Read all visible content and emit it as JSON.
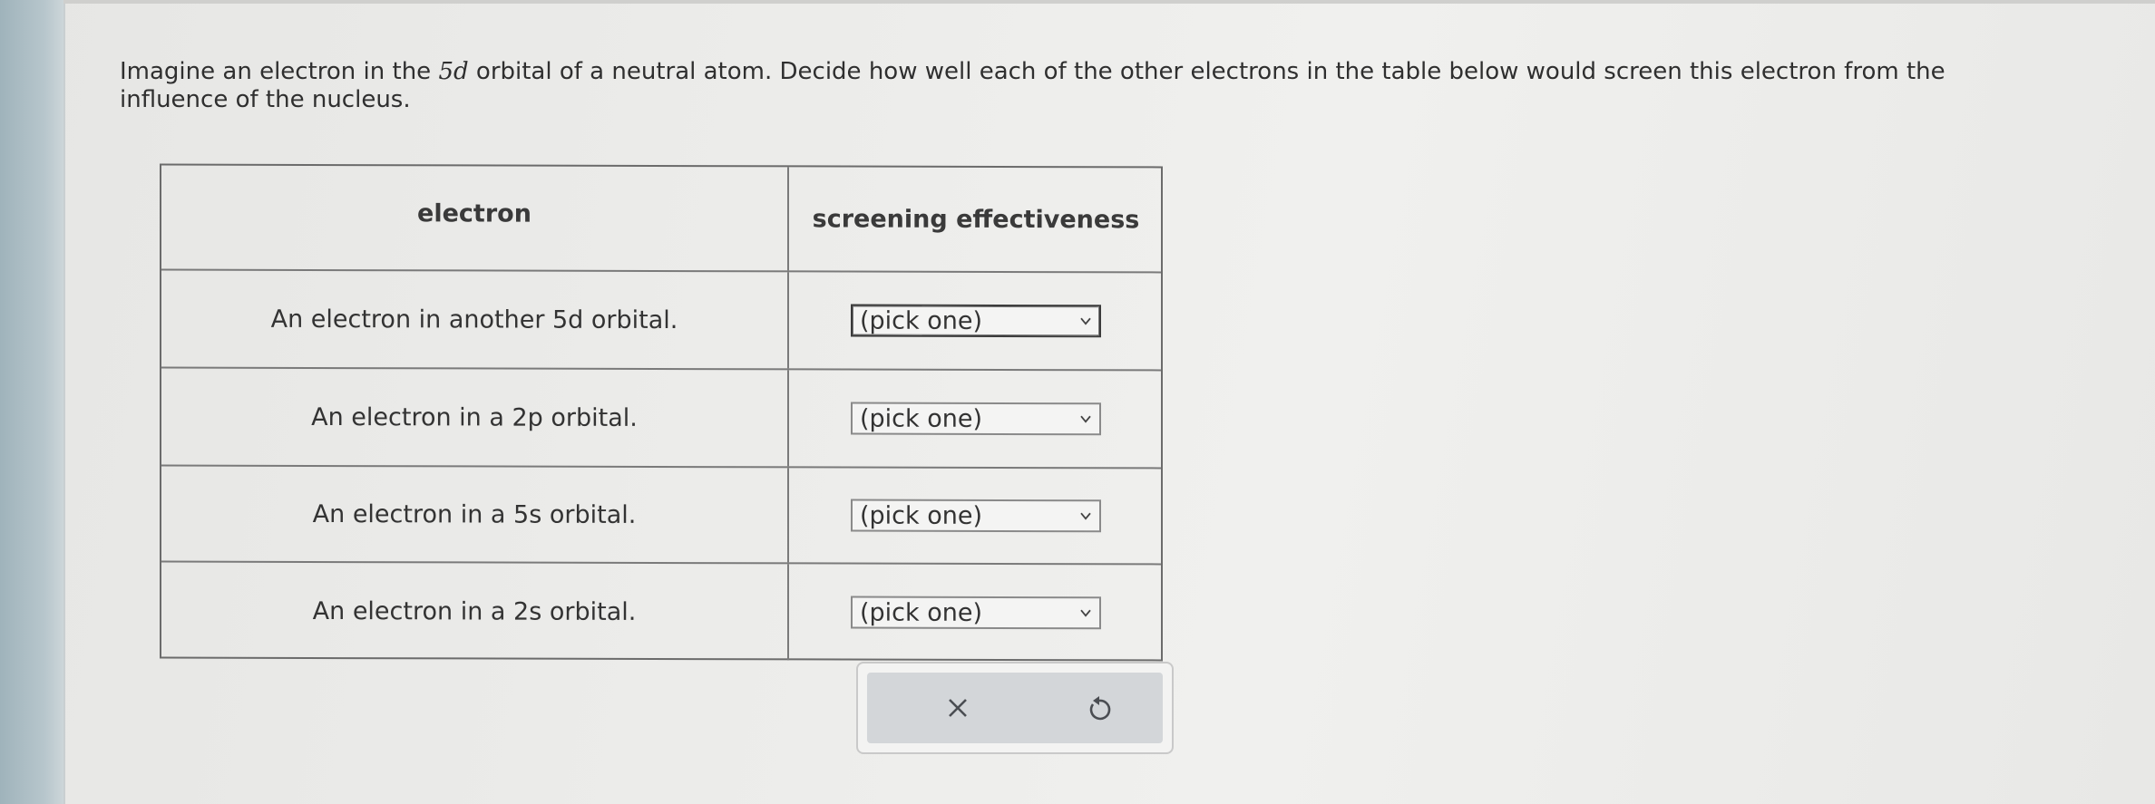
{
  "question": {
    "part1": "Imagine an electron in the ",
    "orbital": "5d",
    "part2": " orbital of a neutral atom. Decide how well each of the other electrons in the table below would screen this electron from the influence of the nucleus."
  },
  "table": {
    "headers": [
      "electron",
      "screening effectiveness"
    ],
    "rows": [
      {
        "electron": "An electron in another 5d orbital.",
        "selection": "(pick one)"
      },
      {
        "electron": "An electron in a 2p orbital.",
        "selection": "(pick one)"
      },
      {
        "electron": "An electron in a 5s orbital.",
        "selection": "(pick one)"
      },
      {
        "electron": "An electron in a 2s orbital.",
        "selection": "(pick one)"
      }
    ]
  },
  "actions": {
    "clear_icon": "close-icon",
    "undo_icon": "undo-icon"
  }
}
